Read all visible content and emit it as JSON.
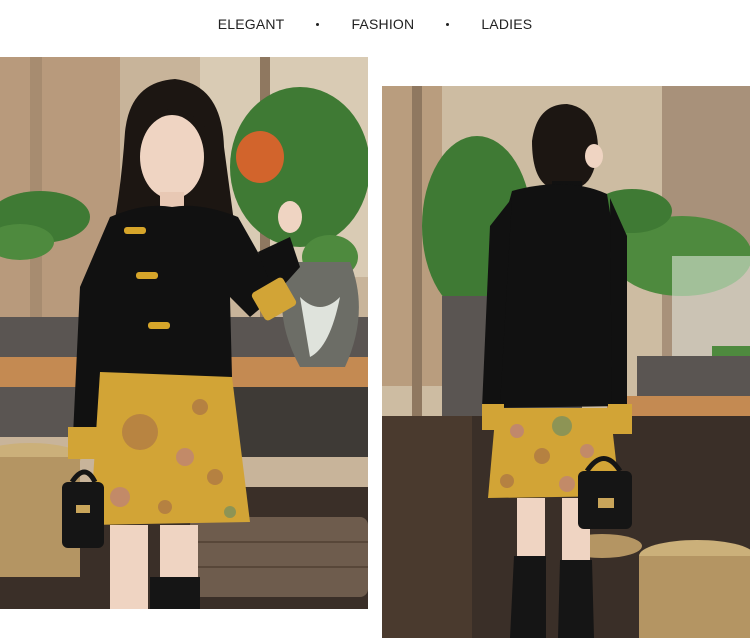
{
  "tagline": {
    "word1": "ELEGANT",
    "word2": "FASHION",
    "word3": "LADIES"
  },
  "photos": [
    {
      "name": "front-view-photo",
      "view": "front"
    },
    {
      "name": "back-view-photo",
      "view": "back"
    }
  ],
  "colors": {
    "jacket": "#111111",
    "skirt": "#d2a436",
    "skirt_pattern": "#a26a4a",
    "plant": "#3f7a34",
    "marble": "#5a5552",
    "floor": "#3a2f28",
    "stool": "#b49563"
  }
}
